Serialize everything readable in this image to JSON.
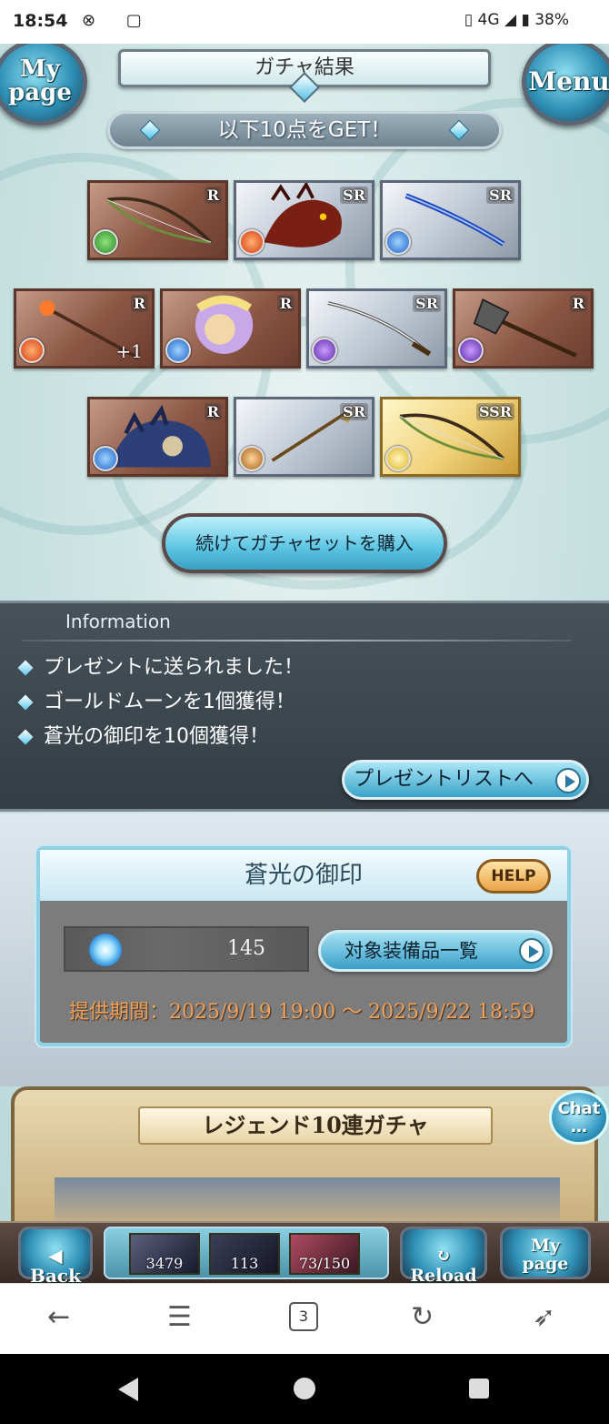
{
  "status_bar": {
    "time": "18:54",
    "left_icons": "⊗ ▢",
    "network": "4G",
    "battery": "38%"
  },
  "header": {
    "title": "ガチャ結果",
    "mypage_label": [
      "My",
      "page"
    ],
    "menu_label": "Menu"
  },
  "result": {
    "banner": "以下10点をGET！",
    "items": [
      {
        "rarity": "R",
        "element": "wind",
        "art": "bow",
        "plus": ""
      },
      {
        "rarity": "SR",
        "element": "fire",
        "art": "dragon",
        "plus": ""
      },
      {
        "rarity": "SR",
        "element": "water",
        "art": "sword",
        "plus": ""
      },
      {
        "rarity": "R",
        "element": "fire",
        "art": "staff",
        "plus": "+1"
      },
      {
        "rarity": "R",
        "element": "water",
        "art": "character",
        "plus": ""
      },
      {
        "rarity": "SR",
        "element": "dark",
        "art": "katana",
        "plus": ""
      },
      {
        "rarity": "R",
        "element": "dark",
        "art": "axe",
        "plus": ""
      },
      {
        "rarity": "R",
        "element": "water",
        "art": "beast",
        "plus": ""
      },
      {
        "rarity": "SR",
        "element": "earth",
        "art": "spear",
        "plus": ""
      },
      {
        "rarity": "SSR",
        "element": "light",
        "art": "bow",
        "plus": ""
      }
    ],
    "continue_button": "続けてガチャセットを購入"
  },
  "information": {
    "title": "Information",
    "lines": [
      "プレゼントに送られました！",
      "ゴールドムーンを1個獲得！",
      "蒼光の御印を10個獲得！"
    ],
    "present_button": "プレゼントリストへ"
  },
  "seal": {
    "title": "蒼光の御印",
    "help": "HELP",
    "count": "145",
    "equip_button": "対象装備品一覧",
    "period": "提供期間：2025/9/19 19:00 〜 2025/9/22 18:59"
  },
  "legend": {
    "title": "レジェンド10連ガチャ",
    "chat": "Chat"
  },
  "game_nav": {
    "back": "Back",
    "resources": [
      "3479",
      "113",
      "73/150"
    ],
    "reload": "Reload",
    "mypage": [
      "My",
      "page"
    ]
  },
  "browser": {
    "tab_count": "3"
  },
  "colors": {
    "accent": "#5cc5e2",
    "period_text": "#f0a05a",
    "info_bg": "#3d474e"
  }
}
